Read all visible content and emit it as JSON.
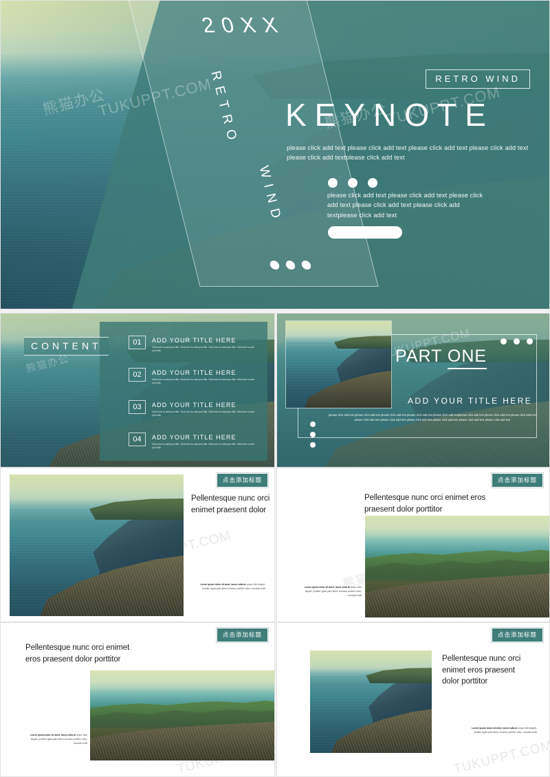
{
  "theme": {
    "accent_teal": "#3f7d79",
    "panel_teal": "#3a7672",
    "white": "#ffffff",
    "page_bg": "#f2f2f2",
    "headline_ink": "#1e1e1e"
  },
  "watermark": {
    "latin": "TUKUPPT.COM",
    "cjk": "熊猫办公"
  },
  "title_slide": {
    "year": "20XX",
    "vertical_word_1": "RETRO",
    "vertical_word_2": "WIND",
    "badge": "RETRO WIND",
    "title": "KEYNOTE",
    "paragraph_1": "please click add text please click add text please click add text please click add text please click add textplease click add text",
    "paragraph_2": "please click add text please click add text please click add text please click add text please click add textplease click add text"
  },
  "content_slide": {
    "label": "CONTENT",
    "items": [
      {
        "num": "01",
        "title": "ADD YOUR TITLE HERE",
        "desc": "Click here to add your title. Click here to add your title. Click here to add your title. Click here to add your title."
      },
      {
        "num": "02",
        "title": "ADD YOUR TITLE HERE",
        "desc": "Click here to add your title. Click here to add your title. Click here to add your title. Click here to add your title."
      },
      {
        "num": "03",
        "title": "ADD YOUR TITLE HERE",
        "desc": "Click here to add your title. Click here to add your title. Click here to add your title. Click here to add your title."
      },
      {
        "num": "04",
        "title": "ADD YOUR TITLE HERE",
        "desc": "Click here to add your title. Click here to add your title. Click here to add your title. Click here to add your title."
      }
    ]
  },
  "part_slide": {
    "title_lead": "PART ",
    "title_underlined": "ONE",
    "subtitle": "ADD YOUR TITLE HERE",
    "body": "please click add text please click add text please click add text please click add text please click add textplease click add text please click add text please click add text please click add text please click add text please click add text please click add text please click add text please click add text"
  },
  "white_slides": [
    {
      "badge": "点击添加标题",
      "headline": "Pellentesque nunc orci enimet praesent dolor",
      "fine_lead": "Lorem ipsum dolor sit amet, lacus nulla at",
      "fine_rest": " neque nibh aliquet, porttitor ligula justo libero vivamus porttitor dolor, conubia mollit"
    },
    {
      "badge": "点击添加标题",
      "headline": "Pellentesque nunc orci enimet eros praesent dolor porttitor",
      "fine_lead": "Lorem ipsum dolor sit amet, lacus nulla at",
      "fine_rest": " neque nibh aliquet, porttitor ligula justo libero vivamus porttitor dolor, conubia mollit"
    },
    {
      "badge": "点击添加标题",
      "headline": "Pellentesque nunc orci enimet eros praesent dolor porttitor",
      "fine_lead": "Lorem ipsum dolor sit amet, lacus nulla at",
      "fine_rest": " neque nibh aliquet, porttitor ligula justo libero vivamus porttitor dolor, conubia mollit"
    },
    {
      "badge": "点击添加标题",
      "headline": "Pellentesque nunc orci enimet eros praesent dolor porttitor",
      "fine_lead": "Lorem ipsum dolor sit amet, lacus nulla at",
      "fine_rest": " neque nibh aliquet, porttitor ligula justo libero vivamus porttitor dolor, conubia mollit"
    }
  ]
}
